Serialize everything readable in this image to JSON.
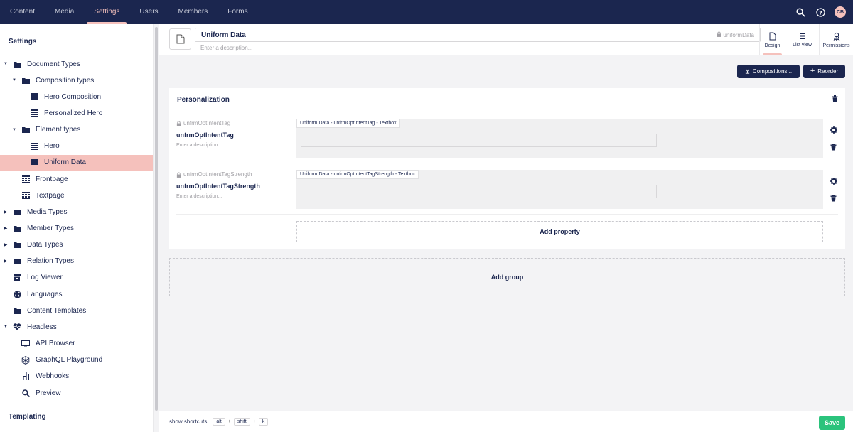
{
  "topnav": {
    "items": [
      {
        "label": "Content",
        "active": false
      },
      {
        "label": "Media",
        "active": false
      },
      {
        "label": "Settings",
        "active": true
      },
      {
        "label": "Users",
        "active": false
      },
      {
        "label": "Members",
        "active": false
      },
      {
        "label": "Forms",
        "active": false
      }
    ],
    "search_icon": "search-icon",
    "help_icon": "help-icon",
    "avatar_initials": "CB"
  },
  "sidebar": {
    "title": "Settings",
    "footer_title": "Templating",
    "items": [
      {
        "label": "Document Types",
        "caret": "down",
        "icon": "folder-icon",
        "level": 0
      },
      {
        "label": "Composition types",
        "caret": "down",
        "icon": "folder-icon",
        "level": 1
      },
      {
        "label": "Hero Composition",
        "caret": "",
        "icon": "grid-icon",
        "level": 2
      },
      {
        "label": "Personalized Hero",
        "caret": "",
        "icon": "grid-icon",
        "level": 2
      },
      {
        "label": "Element types",
        "caret": "down",
        "icon": "folder-icon",
        "level": 1
      },
      {
        "label": "Hero",
        "caret": "",
        "icon": "grid-icon",
        "level": 2
      },
      {
        "label": "Uniform Data",
        "caret": "",
        "icon": "grid-icon",
        "level": 2,
        "selected": true
      },
      {
        "label": "Frontpage",
        "caret": "",
        "icon": "grid-icon",
        "level": 1
      },
      {
        "label": "Textpage",
        "caret": "",
        "icon": "grid-icon",
        "level": 1
      },
      {
        "label": "Media Types",
        "caret": "right",
        "icon": "folder-icon",
        "level": 0
      },
      {
        "label": "Member Types",
        "caret": "right",
        "icon": "folder-icon",
        "level": 0
      },
      {
        "label": "Data Types",
        "caret": "right",
        "icon": "folder-icon",
        "level": 0
      },
      {
        "label": "Relation Types",
        "caret": "right",
        "icon": "folder-icon",
        "level": 0
      },
      {
        "label": "Log Viewer",
        "caret": "",
        "icon": "box-icon",
        "level": 0
      },
      {
        "label": "Languages",
        "caret": "",
        "icon": "globe-icon",
        "level": 0
      },
      {
        "label": "Content Templates",
        "caret": "",
        "icon": "folder-icon",
        "level": 0
      },
      {
        "label": "Headless",
        "caret": "down",
        "icon": "heart-icon",
        "level": 0
      },
      {
        "label": "API Browser",
        "caret": "",
        "icon": "monitor-icon",
        "level": 1
      },
      {
        "label": "GraphQL Playground",
        "caret": "",
        "icon": "gear-icon",
        "level": 1
      },
      {
        "label": "Webhooks",
        "caret": "",
        "icon": "webhook-icon",
        "level": 1
      },
      {
        "label": "Preview",
        "caret": "",
        "icon": "search-icon",
        "level": 1
      }
    ]
  },
  "header": {
    "name": "Uniform Data",
    "alias": "uniformData",
    "description_placeholder": "Enter a description...",
    "apps": [
      {
        "label": "Design",
        "icon": "document-icon",
        "active": true
      },
      {
        "label": "List view",
        "icon": "list-icon",
        "active": false
      },
      {
        "label": "Permissions",
        "icon": "permissions-icon",
        "active": false
      }
    ]
  },
  "toolbar": {
    "compositions_label": "Compositions...",
    "reorder_label": "Reorder"
  },
  "group": {
    "title": "Personalization",
    "properties": [
      {
        "alias": "unfrmOptIntentTag",
        "name": "unfrmOptIntentTag",
        "description": "Enter a description...",
        "editor_label": "Uniform Data - unfrmOptIntentTag - Textbox"
      },
      {
        "alias": "unfrmOptIntentTagStrength",
        "name": "unfrmOptIntentTagStrength",
        "description": "Enter a description...",
        "editor_label": "Uniform Data - unfrmOptIntentTagStrength - Textbox"
      }
    ],
    "add_property_label": "Add property"
  },
  "add_group_label": "Add group",
  "footer": {
    "shortcuts_label": "show shortcuts",
    "keys": [
      "alt",
      "shift",
      "k"
    ],
    "save_label": "Save"
  },
  "colors": {
    "nav_bg": "#1b264f",
    "accent": "#f5c1bc",
    "save": "#2bc37c"
  }
}
